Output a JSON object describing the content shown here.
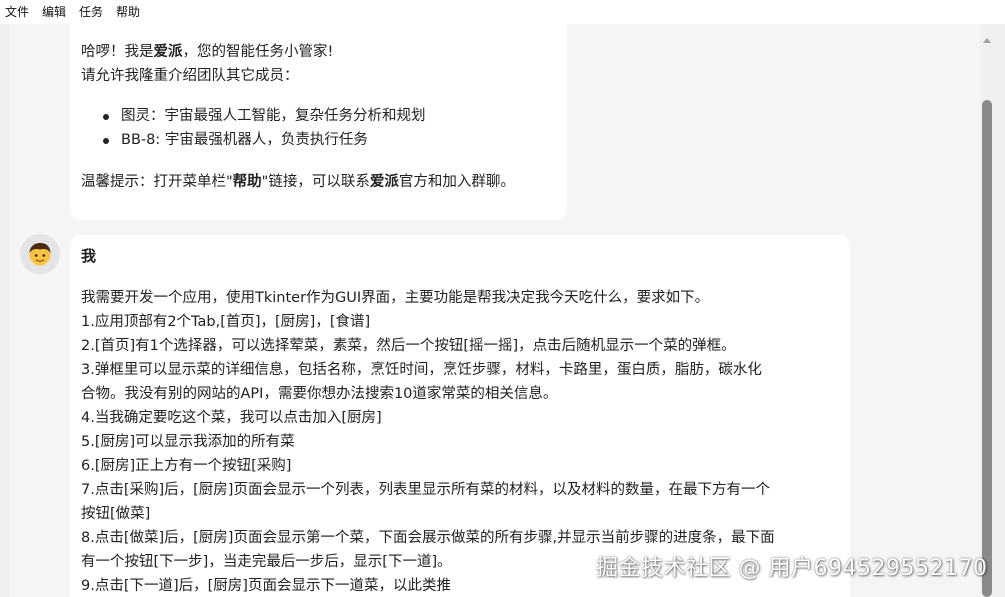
{
  "menubar": {
    "items": [
      "文件",
      "编辑",
      "任务",
      "帮助"
    ]
  },
  "assistant_message": {
    "greeting_prefix": "哈啰！我是",
    "greeting_name": "爱派",
    "greeting_suffix": "，您的智能任务小管家!",
    "intro": "请允许我隆重介绍团队其它成员：",
    "members": [
      "图灵：宇宙最强人工智能，复杂任务分析和规划",
      "BB-8: 宇宙最强机器人，负责执行任务"
    ],
    "tip_prefix": "温馨提示：打开菜单栏\"",
    "tip_bold": "帮助",
    "tip_middle": "\"链接，可以联系",
    "tip_bold2": "爱派",
    "tip_suffix": "官方和加入群聊。"
  },
  "user_message": {
    "name": "我",
    "avatar_icon": "boy-face-emoji",
    "lines": [
      "我需要开发一个应用，使用Tkinter作为GUI界面，主要功能是帮我决定我今天吃什么，要求如下。",
      "1.应用顶部有2个Tab,[首页]，[厨房]，[食谱]",
      "2.[首页]有1个选择器，可以选择荤菜，素菜，然后一个按钮[摇一摇]，点击后随机显示一个菜的弹框。",
      "3.弹框里可以显示菜的详细信息，包括名称，烹饪时间，烹饪步骤，材料，卡路里，蛋白质，脂肪，碳水化",
      "合物。我没有别的网站的API，需要你想办法搜索10道家常菜的相关信息。",
      "4.当我确定要吃这个菜，我可以点击加入[厨房]",
      "5.[厨房]可以显示我添加的所有菜",
      "6.[厨房]正上方有一个按钮[采购]",
      "7.点击[采购]后，[厨房]页面会显示一个列表，列表里显示所有菜的材料，以及材料的数量，在最下方有一个",
      "按钮[做菜]",
      "8.点击[做菜]后，[厨房]页面会显示第一个菜，下面会展示做菜的所有步骤,并显示当前步骤的进度条，最下面",
      "有一个按钮[下一步]，当走完最后一步后，显示[下一道]。",
      "9.点击[下一道]后，[厨房]页面会显示下一道菜，以此类推"
    ]
  },
  "watermark": "掘金技术社区 @ 用户694529552170"
}
